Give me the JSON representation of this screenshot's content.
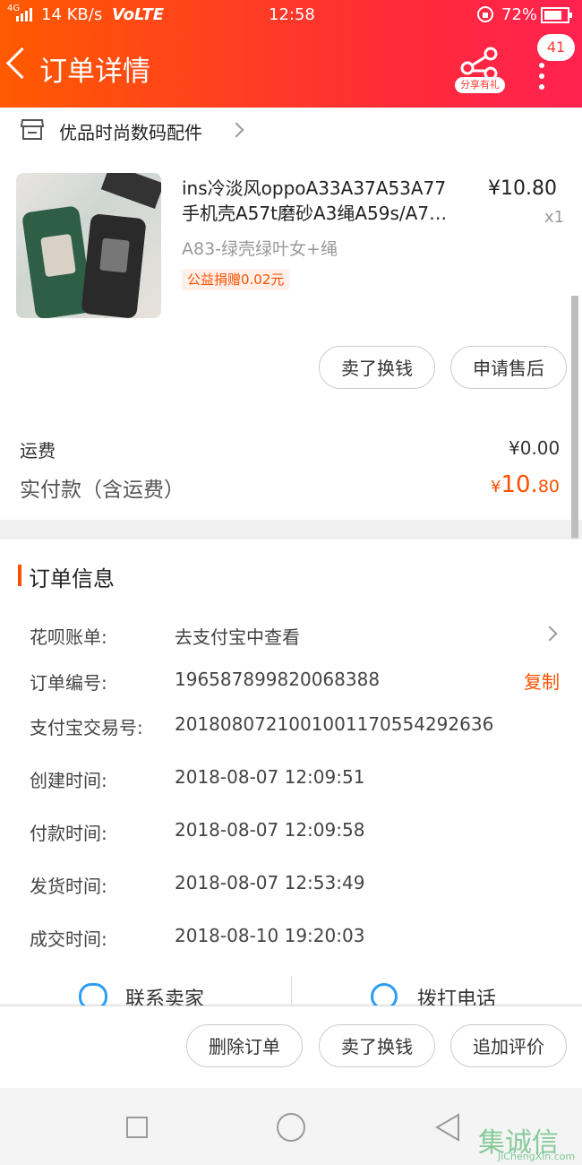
{
  "status_bar": {
    "network": "4G",
    "speed": "14 KB/s",
    "volte": "VoLTE",
    "time": "12:58",
    "battery": "72%"
  },
  "header": {
    "title": "订单详情",
    "share_label": "分享有礼",
    "badge_count": "41"
  },
  "shop": {
    "name": "优品时尚数码配件"
  },
  "product": {
    "name_line1": "ins冷淡风oppoA33A37A53A77",
    "name_line2": "手机壳A57t磨砂A3绳A59s/A7…",
    "price": "¥10.80",
    "quantity": "x1",
    "variant": "A83-绿壳绿叶女+绳",
    "donation_tag": "公益捐赠0.02元",
    "actions": [
      "卖了换钱",
      "申请售后"
    ]
  },
  "payment": {
    "shipping_label": "运费",
    "shipping_value": "¥0.00",
    "paid_label": "实付款（含运费）",
    "paid_symbol": "¥",
    "paid_int": "10.",
    "paid_dec": "80"
  },
  "order_info": {
    "section_title": "订单信息",
    "rows": [
      {
        "label": "花呗账单:",
        "value": "去支付宝中查看"
      },
      {
        "label": "订单编号:",
        "value": "196587899820068388",
        "action": "复制"
      },
      {
        "label": "支付宝交易号:",
        "value": "2018080721001001170554292636"
      },
      {
        "label": "创建时间:",
        "value": "2018-08-07 12:09:51"
      },
      {
        "label": "付款时间:",
        "value": "2018-08-07 12:09:58"
      },
      {
        "label": "发货时间:",
        "value": "2018-08-07 12:53:49"
      },
      {
        "label": "成交时间:",
        "value": "2018-08-10 19:20:03"
      }
    ],
    "contact_seller": "联系卖家",
    "call_phone": "拨打电话"
  },
  "bottom_actions": [
    "删除订单",
    "卖了换钱",
    "追加评价"
  ],
  "watermark": {
    "brand": "集诚信",
    "site": "JiChengXin.com"
  },
  "colors": {
    "accent": "#ff5000",
    "header_start": "#ff5a00",
    "header_end": "#ff2250"
  }
}
